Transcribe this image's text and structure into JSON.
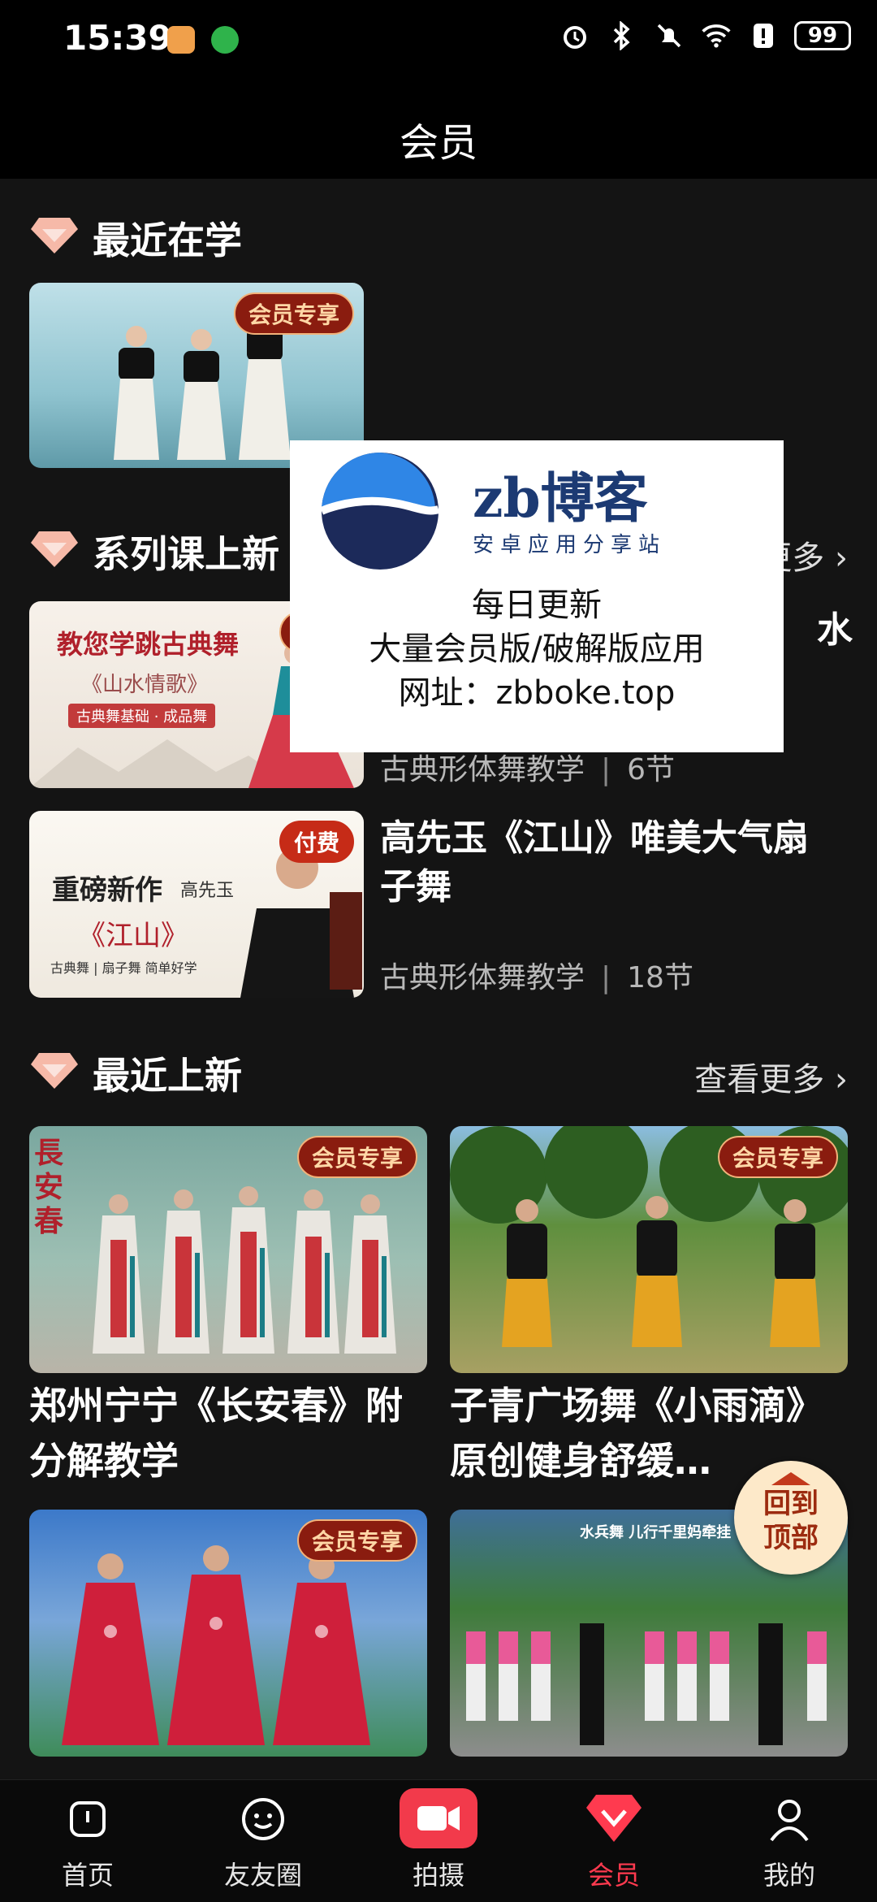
{
  "status_bar": {
    "time": "15:39",
    "battery": "99"
  },
  "header": {
    "title": "会员"
  },
  "sections": {
    "recent_learning": {
      "title": "最近在学",
      "badge": "会员专享"
    },
    "series_new": {
      "title": "系列课上新",
      "see_more": "更多",
      "courses": [
        {
          "title": "教您学跳古典舞《山水情歌》",
          "visible_title_tail": "水",
          "category": "古典形体舞教学",
          "lessons": "6节",
          "badge": "会员",
          "thumb_title": "教您学跳古典舞",
          "thumb_sub": "《山水情歌》",
          "thumb_caption": "古典舞基础 · 成品舞"
        },
        {
          "title": "高先玉《江山》唯美大气扇子舞",
          "category": "古典形体舞教学",
          "lessons": "18节",
          "badge": "付费",
          "thumb_title": "重磅新作",
          "thumb_author": "高先玉",
          "thumb_sub": "《江山》",
          "thumb_caption": "古典舞 | 扇子舞 简单好学"
        }
      ]
    },
    "recent_new": {
      "title": "最近上新",
      "see_more": "查看更多",
      "items": [
        {
          "title": "郑州宁宁《长安春》附分解教学",
          "badge": "会员专享",
          "thumb_text": "長安春"
        },
        {
          "title": "子青广场舞《小雨滴》原创健身舒缓…",
          "badge": "会员专享"
        },
        {
          "title": "",
          "badge": "会员专享"
        },
        {
          "title": "",
          "badge": "",
          "thumb_text": "水兵舞 儿行千里妈牵挂"
        }
      ]
    }
  },
  "overlay": {
    "brand": "zb博客",
    "subtitle": "安卓应用分享站",
    "line1": "每日更新",
    "line2": "大量会员版/破解版应用",
    "line3": "网址：zbboke.top"
  },
  "back_to_top": {
    "line1": "回到",
    "line2": "顶部"
  },
  "bottom_nav": [
    {
      "label": "首页",
      "icon": "home-icon"
    },
    {
      "label": "友友圈",
      "icon": "smile-icon"
    },
    {
      "label": "拍摄",
      "icon": "video-camera-icon"
    },
    {
      "label": "会员",
      "icon": "diamond-icon"
    },
    {
      "label": "我的",
      "icon": "user-icon"
    }
  ],
  "colors": {
    "accent": "#ff3a4f",
    "badge_bg": "#8a1c0f",
    "badge_text": "#ffd7a6",
    "diamond": "#f6b9a8"
  }
}
